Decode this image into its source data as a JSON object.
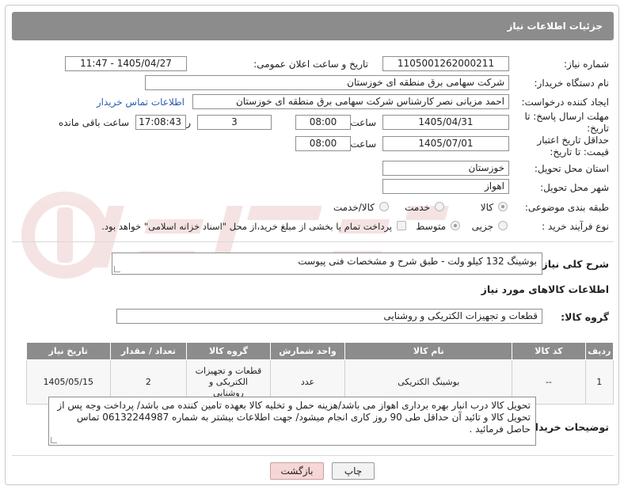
{
  "header": {
    "title": "جزئیات اطلاعات نیاز"
  },
  "fields": {
    "need_number_label": "شماره نیاز:",
    "need_number": "1105001262000211",
    "announce_label": "تاریخ و ساعت اعلان عمومی:",
    "announce_value": "1405/04/27 - 11:47",
    "buyer_org_label": "نام دستگاه خریدار:",
    "buyer_org": "شرکت سهامی برق منطقه ای خوزستان",
    "creator_label": "ایجاد کننده درخواست:",
    "creator": "احمد مزبانی نصر کارشناس شرکت سهامی برق منطقه ای خوزستان",
    "buyer_contact_link": "اطلاعات تماس خریدار",
    "reply_deadline_label": "مهلت ارسال پاسخ: تا تاریخ:",
    "reply_date": "1405/04/31",
    "time_label": "ساعت",
    "reply_time": "08:00",
    "days_value": "3",
    "days_label": "روز و",
    "remaining_time": "17:08:43",
    "remaining_label": "ساعت باقی مانده",
    "price_validity_label": "حداقل تاریخ اعتبار قیمت: تا تاریخ:",
    "price_date": "1405/07/01",
    "price_time": "08:00",
    "delivery_province_label": "استان محل تحویل:",
    "delivery_province": "خوزستان",
    "delivery_city_label": "شهر محل تحویل:",
    "delivery_city": "اهواز",
    "category_label": "طبقه بندی موضوعی:",
    "category_opt1": "کالا",
    "category_opt2": "خدمت",
    "category_opt3": "کالا/خدمت",
    "process_label": "نوع فرآیند خرید :",
    "process_opt1": "جزیی",
    "process_opt2": "متوسط",
    "payment_note": "پرداخت تمام یا بخشی از مبلغ خرید،از محل \"اسناد خزانه اسلامی\" خواهد بود."
  },
  "summary": {
    "label": "شرح کلی نیاز:",
    "text": "بوشینگ 132 کیلو ولت - طبق شرح و مشخصات فنی پیوست"
  },
  "goods_section": {
    "title": "اطلاعات کالاهای مورد نیاز",
    "group_label": "گروه کالا:",
    "group_value": "قطعات و تجهیزات الکتریکی و روشنایی"
  },
  "table": {
    "headers": [
      "ردیف",
      "کد کالا",
      "نام کالا",
      "واحد شمارش",
      "گروه کالا",
      "تعداد / مقدار",
      "تاریخ نیاز"
    ],
    "rows": [
      [
        "1",
        "--",
        "بوشینگ الکتریکی",
        "عدد",
        "قطعات و تجهیزات الکتریکی و روشنایی",
        "2",
        "1405/05/15"
      ]
    ]
  },
  "buyer_notes": {
    "label": "توضیحات خریدار:",
    "text": "تحویل کالا درب انبار بهره برداری اهواز می باشد/هزینه حمل و تخلیه کالا بعهده تامین کننده می باشد/ پرداخت وجه پس از تحویل کالا و تائید آن حداقل طی 90 روز کاری انجام میشود/  جهت اطلاعات بیشتر به شماره  06132244987 تماس حاصل فرمائید ."
  },
  "buttons": {
    "print": "چاپ",
    "back": "بازگشت"
  },
  "colors": {
    "header_bg": "#8c8c8c",
    "link": "#2a5db0",
    "back_button_bg": "#f6d6d6",
    "print_button_bg": "#f2f2f2"
  }
}
